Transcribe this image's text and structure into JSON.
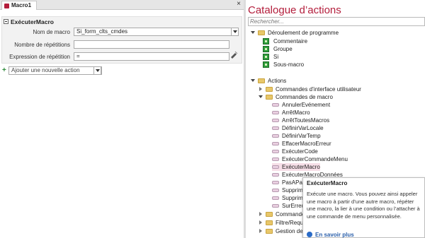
{
  "tab": {
    "title": "Macro1"
  },
  "close_glyph": "×",
  "action_block": {
    "title": "ExécuterMacro",
    "params": [
      {
        "label": "Nom de macro",
        "value": "Si_form_clts_cmdes"
      },
      {
        "label": "Nombre de répétitions",
        "value": ""
      },
      {
        "label": "Expression de répétition",
        "value": "="
      }
    ]
  },
  "add_action": {
    "plus": "+",
    "placeholder": "Ajouter une nouvelle action"
  },
  "catalog": {
    "title": "Catalogue d’actions",
    "search_placeholder": "Rechercher...",
    "flow": {
      "label": "Déroulement de programme",
      "items": [
        "Commentaire",
        "Groupe",
        "Si",
        "Sous-macro"
      ]
    },
    "actions": {
      "label": "Actions",
      "ui_commands": "Commandes d’interface utilisateur",
      "macro_commands": "Commandes de macro",
      "macro_items": [
        "AnnulerEvénement",
        "ArrêtMacro",
        "ArrêtToutesMacros",
        "DéfinirVarLocale",
        "DéfinirVarTemp",
        "EffacerMacroErreur",
        "ExécuterCode",
        "ExécuterCommandeMenu",
        "ExécuterMacro",
        "ExécuterMacroDonnées",
        "PasAPas",
        "Supprim",
        "Supprim",
        "SurErreu"
      ],
      "selected_item": "ExécuterMacro",
      "more_groups": [
        "Commande",
        "Filtre/Requ",
        "Gestion de"
      ]
    }
  },
  "tooltip": {
    "title": "ExécuterMacro",
    "text": "Exécute une macro. Vous pouvez ainsi appeler une macro à partir d’une autre macro, répéter une macro, la lier à une condition ou l’attacher à une commande de menu personnalisée.",
    "help_link": "En savoir plus"
  },
  "colors": {
    "accent": "#b31d3b",
    "selection": "#f7dfe8",
    "green_icon": "#2f9e3b"
  }
}
